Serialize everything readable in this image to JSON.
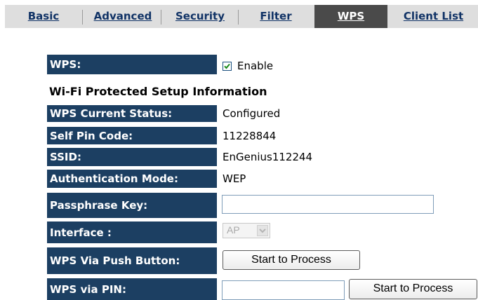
{
  "tabs": [
    {
      "label": "Basic",
      "active": false
    },
    {
      "label": "Advanced",
      "active": false
    },
    {
      "label": "Security",
      "active": false
    },
    {
      "label": "Filter",
      "active": false
    },
    {
      "label": "WPS",
      "active": true
    },
    {
      "label": "Client List",
      "active": false
    }
  ],
  "wps": {
    "label": "WPS:",
    "enable_label": "Enable",
    "enabled": true
  },
  "section_title": "Wi-Fi Protected Setup Information",
  "rows": {
    "status": {
      "label": "WPS Current Status:",
      "value": "Configured"
    },
    "pin": {
      "label": "Self Pin Code:",
      "value": "11228844"
    },
    "ssid": {
      "label": "SSID:",
      "value": "EnGenius112244"
    },
    "auth": {
      "label": "Authentication Mode:",
      "value": "WEP"
    },
    "passphrase": {
      "label": "Passphrase Key:",
      "value": ""
    },
    "interface": {
      "label": "Interface :",
      "selected": "AP"
    },
    "push": {
      "label": "WPS Via Push Button:",
      "button": "Start to Process"
    },
    "via_pin": {
      "label": "WPS via PIN:",
      "value": "",
      "button": "Start to Process"
    }
  },
  "colors": {
    "label_bg": "#1c3f62",
    "tab_active_bg": "#4a4a4a",
    "tab_bar_bg": "#dedede",
    "tab_link": "#113366"
  }
}
